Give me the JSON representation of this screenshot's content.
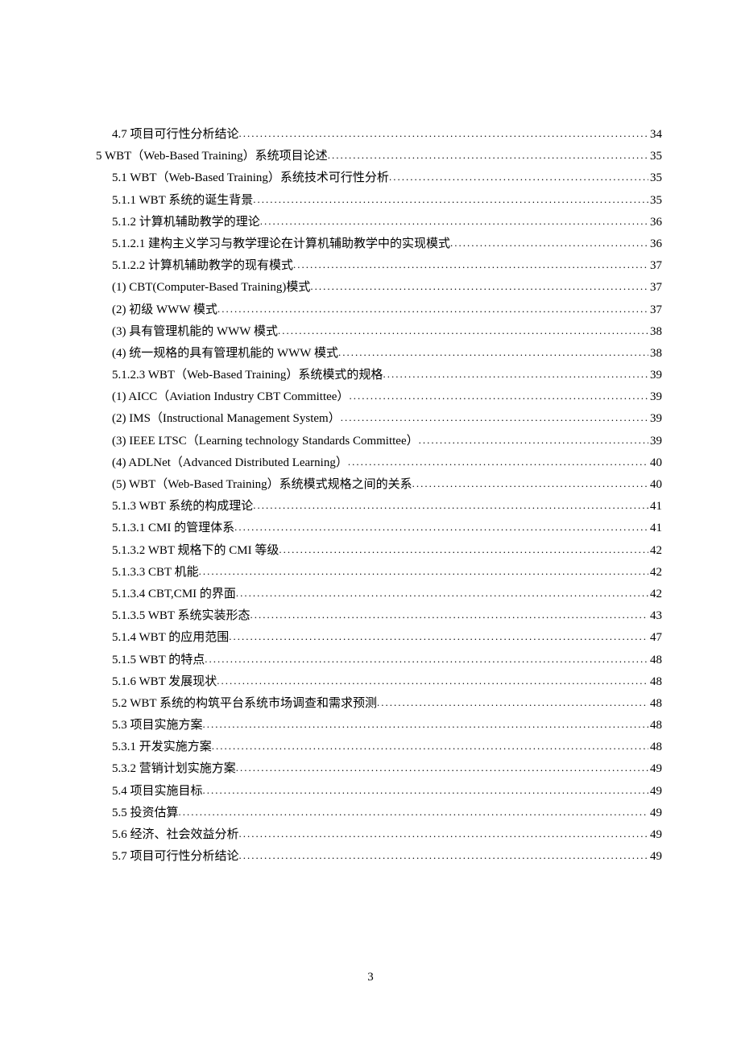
{
  "toc": [
    {
      "label": "4.7 项目可行性分析结论",
      "page": "34",
      "indent": "ind2"
    },
    {
      "label": "5  WBT（Web-Based Training）系统项目论述",
      "page": "35",
      "indent": "ind1"
    },
    {
      "label": "5.1 WBT（Web-Based Training）系统技术可行性分析",
      "page": "35",
      "indent": "ind2"
    },
    {
      "label": "5.1.1 WBT 系统的诞生背景",
      "page": "35",
      "indent": "ind2"
    },
    {
      "label": "5.1.2 计算机辅助教学的理论",
      "page": "36",
      "indent": "ind2"
    },
    {
      "label": "5.1.2.1 建构主义学习与教学理论在计算机辅助教学中的实现模式",
      "page": "36",
      "indent": "ind2"
    },
    {
      "label": "5.1.2.2 计算机辅助教学的现有模式",
      "page": "37",
      "indent": "ind2"
    },
    {
      "label": "(1) CBT(Computer-Based Training)模式",
      "page": "37",
      "indent": "ind2"
    },
    {
      "label": "(2) 初级 WWW 模式",
      "page": "37",
      "indent": "ind2"
    },
    {
      "label": "(3) 具有管理机能的 WWW 模式",
      "page": "38",
      "indent": "ind2"
    },
    {
      "label": "(4) 统一规格的具有管理机能的 WWW 模式",
      "page": "38",
      "indent": "ind2"
    },
    {
      "label": "5.1.2.3 WBT（Web-Based Training）系统模式的规格",
      "page": "39",
      "indent": "ind2"
    },
    {
      "label": "(1) AICC（Aviation Industry CBT Committee）",
      "page": "39",
      "indent": "ind2"
    },
    {
      "label": "(2) IMS（Instructional Management System）",
      "page": "39",
      "indent": "ind2"
    },
    {
      "label": "(3) IEEE LTSC（Learning technology Standards Committee）",
      "page": "39",
      "indent": "ind2"
    },
    {
      "label": "(4) ADLNet（Advanced Distributed Learning）",
      "page": "40",
      "indent": "ind2"
    },
    {
      "label": "(5) WBT（Web-Based Training）系统模式规格之间的关系",
      "page": "40",
      "indent": "ind2"
    },
    {
      "label": "5.1.3 WBT 系统的构成理论",
      "page": "41",
      "indent": "ind2"
    },
    {
      "label": "5.1.3.1 CMI 的管理体系",
      "page": "41",
      "indent": "ind2"
    },
    {
      "label": "5.1.3.2 WBT 规格下的 CMI 等级",
      "page": "42",
      "indent": "ind2"
    },
    {
      "label": "5.1.3.3 CBT 机能",
      "page": "42",
      "indent": "ind2"
    },
    {
      "label": "5.1.3.4 CBT,CMI 的界面",
      "page": "42",
      "indent": "ind2"
    },
    {
      "label": "5.1.3.5  WBT 系统实装形态",
      "page": "43",
      "indent": "ind2"
    },
    {
      "label": "5.1.4 WBT 的应用范围",
      "page": "47",
      "indent": "ind2"
    },
    {
      "label": "5.1.5 WBT 的特点",
      "page": "48",
      "indent": "ind2"
    },
    {
      "label": "5.1.6 WBT 发展现状",
      "page": "48",
      "indent": "ind2"
    },
    {
      "label": "5.2 WBT 系统的构筑平台系统市场调查和需求预测",
      "page": "48",
      "indent": "ind2"
    },
    {
      "label": "5.3 项目实施方案",
      "page": "48",
      "indent": "ind2"
    },
    {
      "label": "5.3.1 开发实施方案",
      "page": "48",
      "indent": "ind2"
    },
    {
      "label": "5.3.2 营销计划实施方案",
      "page": "49",
      "indent": "ind2"
    },
    {
      "label": "5.4 项目实施目标",
      "page": "49",
      "indent": "ind2"
    },
    {
      "label": "5.5 投资估算",
      "page": "49",
      "indent": "ind2"
    },
    {
      "label": "5.6 经济、社会效益分析",
      "page": "49",
      "indent": "ind2"
    },
    {
      "label": "5.7 项目可行性分析结论",
      "page": "49",
      "indent": "ind2"
    }
  ],
  "pageNumber": "3"
}
